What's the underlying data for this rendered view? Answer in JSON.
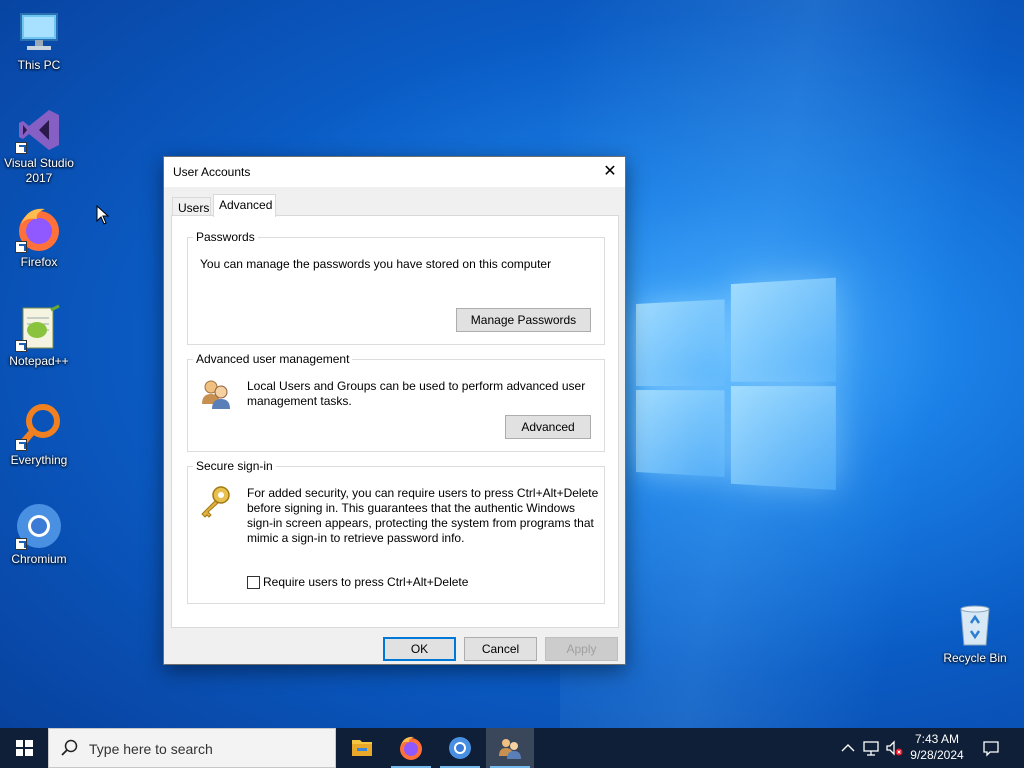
{
  "desktop": {
    "icons": [
      {
        "label": "This PC"
      },
      {
        "label": "Visual Studio 2017"
      },
      {
        "label": "Firefox"
      },
      {
        "label": "Notepad++"
      },
      {
        "label": "Everything"
      },
      {
        "label": "Chromium"
      },
      {
        "label": "Recycle Bin"
      }
    ]
  },
  "dialog": {
    "title": "User Accounts",
    "close_glyph": "✕",
    "tabs": [
      {
        "label": "Users",
        "active": false
      },
      {
        "label": "Advanced",
        "active": true
      }
    ],
    "passwords": {
      "title": "Passwords",
      "text": "You can manage the passwords you have stored on this computer",
      "button": "Manage Passwords"
    },
    "advanced_user_management": {
      "title": "Advanced user management",
      "text": "Local Users and Groups can be used to perform advanced user management tasks.",
      "button": "Advanced"
    },
    "secure_sign_in": {
      "title": "Secure sign-in",
      "text": "For added security, you can require users to press Ctrl+Alt+Delete before signing in. This guarantees that the authentic Windows sign-in screen appears, protecting the system from programs that mimic a sign-in to retrieve password info.",
      "checkbox_label": "Require users to press Ctrl+Alt+Delete",
      "checkbox_checked": false
    },
    "buttons": {
      "ok": "OK",
      "cancel": "Cancel",
      "apply": "Apply"
    }
  },
  "taskbar": {
    "search_placeholder": "Type here to search",
    "apps": [
      "file-explorer-icon",
      "firefox-icon",
      "chromium-icon",
      "user-accounts-icon"
    ],
    "clock": {
      "time": "7:43 AM",
      "date": "9/28/2024"
    }
  },
  "colors": {
    "accent": "#0078d7",
    "taskbar": "#0f1f37"
  }
}
